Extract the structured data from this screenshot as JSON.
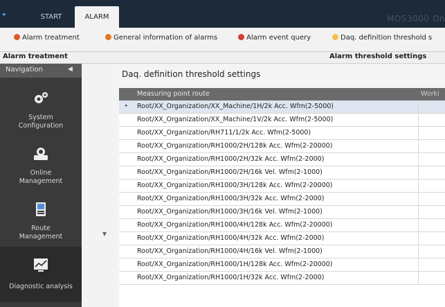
{
  "window": {
    "tabs": [
      {
        "label": "START",
        "active": false
      },
      {
        "label": "ALARM",
        "active": true
      }
    ],
    "brand": "MOS3000 On"
  },
  "toolbar": {
    "items": [
      {
        "label": "Alarm treatment",
        "icon": "alarm-treatment-icon",
        "color": "#e0572a"
      },
      {
        "label": "General information of alarms",
        "icon": "general-info-icon",
        "color": "#e8761f"
      },
      {
        "label": "Alarm event query",
        "icon": "alarm-query-icon",
        "color": "#d63b30"
      },
      {
        "label": "Daq. definition threshold s",
        "icon": "threshold-icon",
        "color": "#f2c14e"
      }
    ]
  },
  "sections": {
    "left": "Alarm treatment",
    "right": "Alarm threshold settings"
  },
  "navigation": {
    "header": "Navigation",
    "collapse_icon": "◀",
    "items": [
      {
        "label": "System\nConfiguration",
        "icon": "gears-icon"
      },
      {
        "label": "Online\nManagement",
        "icon": "online-icon"
      },
      {
        "label": "Route\nManagement",
        "icon": "route-icon"
      },
      {
        "label": "Diagnostic analysis",
        "icon": "diagnostic-icon"
      }
    ]
  },
  "main": {
    "title": "Daq. definition threshold settings",
    "columns": [
      "Measuring point route",
      "Worki"
    ],
    "rows": [
      "Root/XX_Organization/XX_Machine/1H/2k Acc. Wfm(2-5000)",
      "Root/XX_Organization/XX_Machine/1V/2k Acc. Wfm(2-5000)",
      "Root/XX_Organization/RH711/1/2k Acc. Wfm(2-5000)",
      "Root/XX_Organization/RH1000/2H/128k Acc. Wfm(2-20000)",
      "Root/XX_Organization/RH1000/2H/32k Acc. Wfm(2-2000)",
      "Root/XX_Organization/RH1000/2H/16k Vel. Wfm(2-1000)",
      "Root/XX_Organization/RH1000/3H/128k Acc. Wfm(2-20000)",
      "Root/XX_Organization/RH1000/3H/32k Acc. Wfm(2-2000)",
      "Root/XX_Organization/RH1000/3H/16k Vel. Wfm(2-1000)",
      "Root/XX_Organization/RH1000/4H/128k Acc. Wfm(2-20000)",
      "Root/XX_Organization/RH1000/4H/32k Acc. Wfm(2-2000)",
      "Root/XX_Organization/RH1000/4H/16k Vel. Wfm(2-1000)",
      "Root/XX_Organization/RH1000/1H/128k Acc. Wfm(2-20000)",
      "Root/XX_Organization/RH1000/1H/32k Acc. Wfm(2-2000)"
    ]
  }
}
